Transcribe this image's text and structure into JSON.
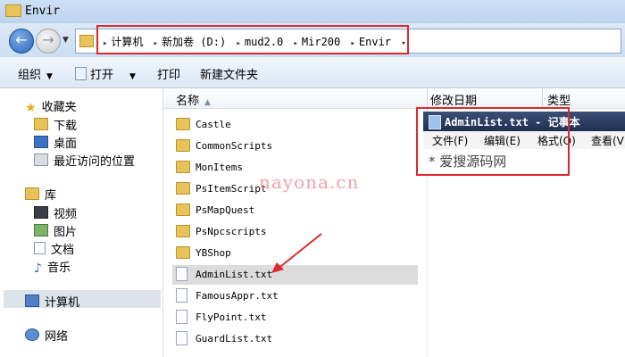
{
  "window": {
    "title": "Envir"
  },
  "address": {
    "crumbs": [
      "计算机",
      "新加卷 (D:)",
      "mud2.0",
      "Mir200",
      "Envir"
    ]
  },
  "toolbar": {
    "organize_label": "组织",
    "open_label": "打开",
    "print_label": "打印",
    "new_folder_label": "新建文件夹"
  },
  "nav": {
    "favorites_label": "收藏夹",
    "favorites": [
      "下载",
      "桌面",
      "最近访问的位置"
    ],
    "libraries_label": "库",
    "libraries": [
      "视频",
      "图片",
      "文档",
      "音乐"
    ],
    "computer_label": "计算机",
    "network_label": "网络"
  },
  "columns": {
    "name": "名称",
    "modified": "修改日期",
    "type": "类型"
  },
  "files": [
    {
      "name": "Castle",
      "kind": "folder"
    },
    {
      "name": "CommonScripts",
      "kind": "folder"
    },
    {
      "name": "MonItems",
      "kind": "folder"
    },
    {
      "name": "PsItemScript",
      "kind": "folder"
    },
    {
      "name": "PsMapQuest",
      "kind": "folder"
    },
    {
      "name": "PsNpcscripts",
      "kind": "folder"
    },
    {
      "name": "YBShop",
      "kind": "folder"
    },
    {
      "name": "AdminList.txt",
      "kind": "txt",
      "selected": true
    },
    {
      "name": "FamousAppr.txt",
      "kind": "txt"
    },
    {
      "name": "FlyPoint.txt",
      "kind": "txt"
    },
    {
      "name": "GuardList.txt",
      "kind": "txt"
    }
  ],
  "notepad": {
    "title": "AdminList.txt - 记事本",
    "menu": [
      "文件(F)",
      "编辑(E)",
      "格式(O)",
      "查看(V)"
    ],
    "content": "* 爱搜源码网"
  },
  "watermark": "nayona.cn",
  "colors": {
    "highlight_box": "#e0262e",
    "selection": "#dcdcdc",
    "notepad_title_bg": "#1f2f52"
  }
}
